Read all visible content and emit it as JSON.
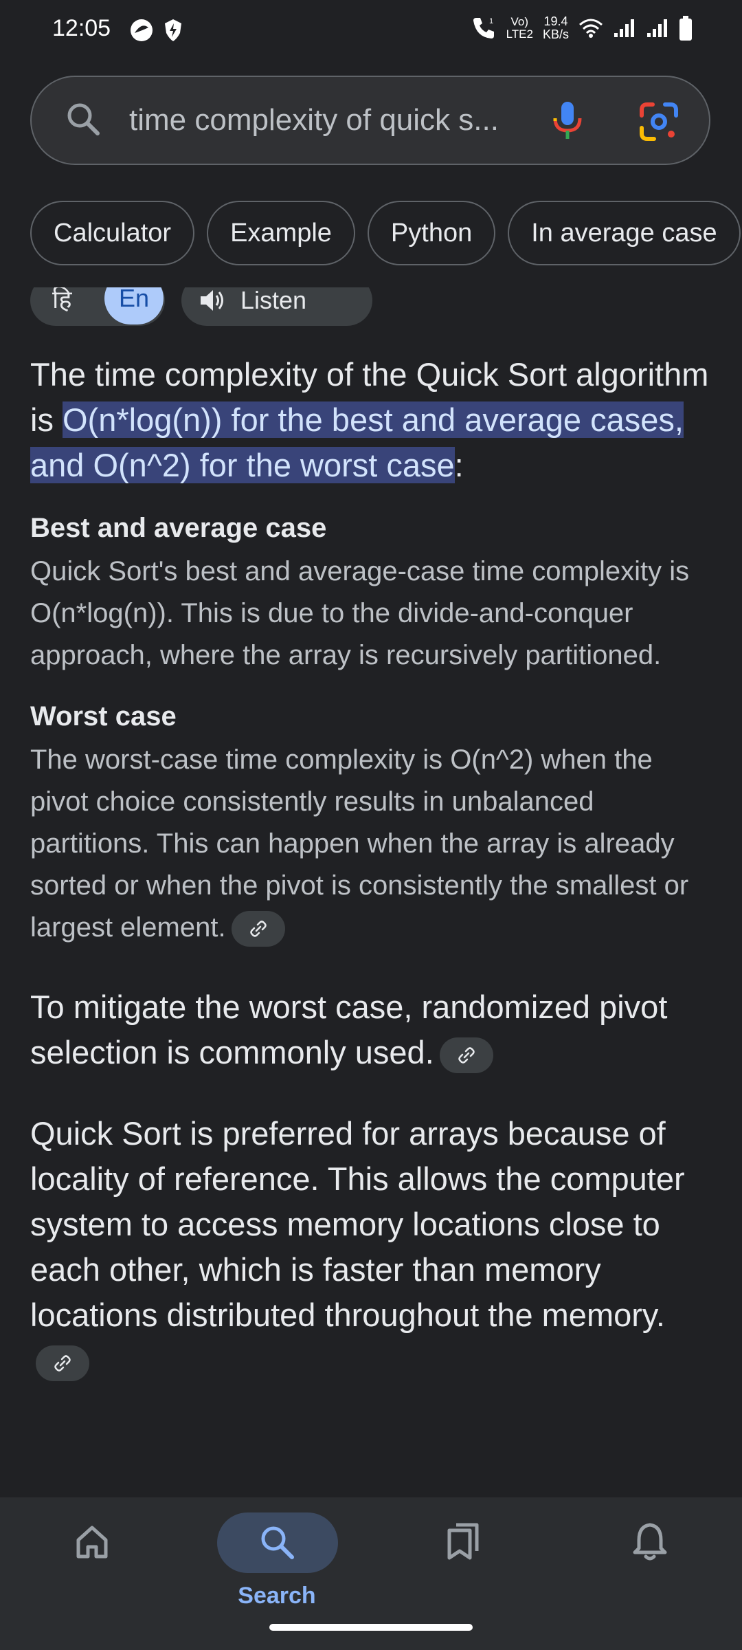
{
  "status_bar": {
    "time": "12:05",
    "network_label_top": "Vo)",
    "network_label_bottom": "LTE2",
    "speed_value": "19.4",
    "speed_unit": "KB/s"
  },
  "search": {
    "query": "time complexity of quick s...",
    "icons": [
      "search-icon",
      "mic-icon",
      "google-lens-icon"
    ]
  },
  "chips": [
    "Calculator",
    "Example",
    "Python",
    "In average case"
  ],
  "lang": {
    "hi": "हि",
    "en": "En",
    "listen": "Listen"
  },
  "answer": {
    "lead_before": "The time complexity of the Quick Sort algorithm is ",
    "lead_highlight": "O(n*log(n)) for the best and average cases, and O(n^2) for the worst case",
    "lead_after": ":",
    "section1_title": "Best and average case",
    "section1_body": "Quick Sort's best and average-case time complexity is O(n*log(n)). This is due to the divide-and-conquer approach, where the array is recursively partitioned.",
    "section2_title": "Worst case",
    "section2_body": "The worst-case time complexity is O(n^2) when the pivot choice consistently results in unbalanced partitions. This can happen when the array is already sorted or when the pivot is consistently the smallest or largest element.",
    "para3": "To mitigate the worst case, randomized pivot selection is commonly used.",
    "para4": "Quick Sort is preferred for arrays because of locality of reference. This allows the computer system to access memory locations close to each other, which is faster than memory locations distributed throughout the memory."
  },
  "bottom_nav": {
    "items": [
      {
        "name": "home",
        "label": ""
      },
      {
        "name": "search",
        "label": "Search"
      },
      {
        "name": "saved",
        "label": ""
      },
      {
        "name": "notifications",
        "label": ""
      }
    ]
  },
  "colors": {
    "background": "#202124",
    "highlight": "#394479",
    "accent": "#8ab4f8"
  }
}
